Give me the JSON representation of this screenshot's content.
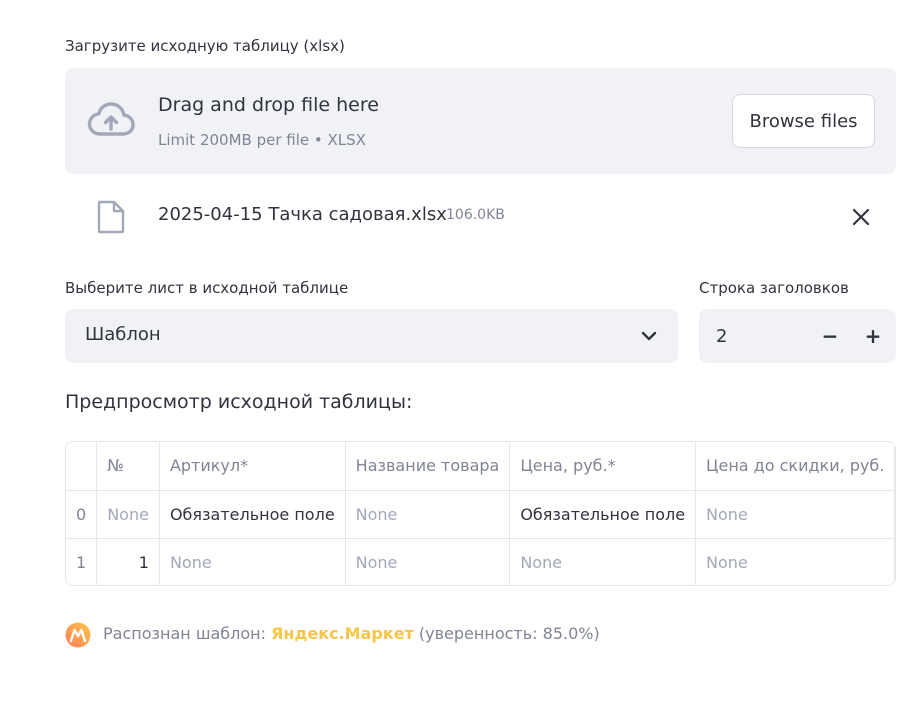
{
  "uploader": {
    "label": "Загрузите исходную таблицу (xlsx)",
    "drop_title": "Drag and drop file here",
    "limit_text": "Limit 200MB per file • XLSX",
    "browse_label": "Browse files",
    "file_name": "2025-04-15 Тачка садовая.xlsx",
    "file_size": "106.0KB"
  },
  "sheet_select": {
    "label": "Выберите лист в исходной таблице",
    "value": "Шаблон"
  },
  "header_row": {
    "label": "Строка заголовков",
    "value": "2",
    "minus": "−",
    "plus": "+"
  },
  "preview": {
    "title": "Предпросмотр исходной таблицы:",
    "columns": [
      "",
      "№",
      "Артикул*",
      "Название товара",
      "Цена, руб.*",
      "Цена до скидки, руб."
    ],
    "rows": [
      [
        "0",
        "None",
        "Обязательное поле",
        "None",
        "Обязательное поле",
        "None"
      ],
      [
        "1",
        "1",
        "None",
        "None",
        "None",
        "None"
      ]
    ]
  },
  "status": {
    "prefix": "Распознан шаблон: ",
    "template": "Яндекс.Маркет",
    "suffix": " (уверенность: 85.0%)"
  },
  "colors": {
    "accent": "#f7c547",
    "widget_bg": "#f0f2f6",
    "muted_text": "#808495"
  },
  "icons": {
    "upload": "cloud-upload-icon",
    "file": "file-icon",
    "close": "close-icon",
    "dropdown": "chevron-down-icon",
    "logo": "yandex-market-logo-icon"
  }
}
